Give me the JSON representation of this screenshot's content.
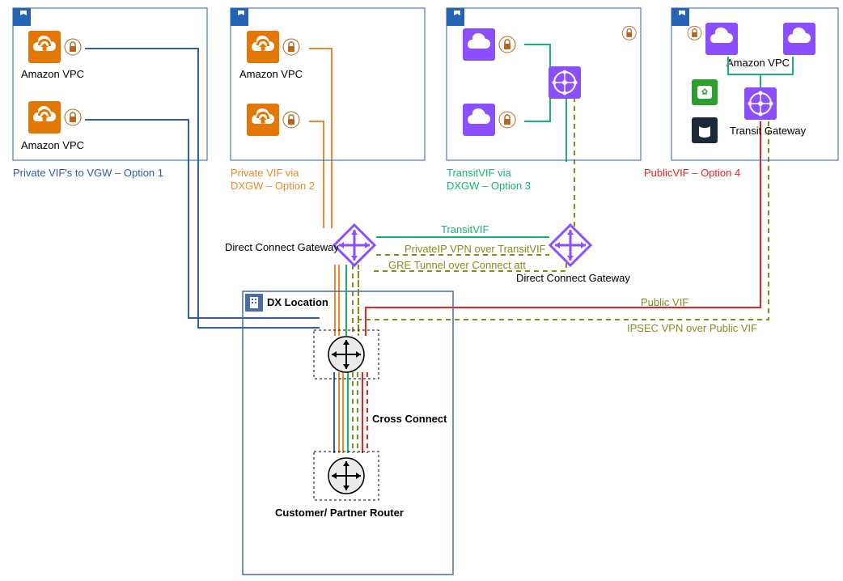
{
  "groups": {
    "g1": {
      "vpc1": "Amazon VPC",
      "vpc2": "Amazon VPC",
      "opt": "Private VIF's to VGW – Option 1"
    },
    "g2": {
      "vpc1": "Amazon VPC",
      "opt1": "Private VIF via",
      "opt2": "DXGW – Option 2"
    },
    "g3": {
      "opt1": "TransitVIF via",
      "opt2": "DXGW – Option 3"
    },
    "g4": {
      "vpc": "Amazon VPC",
      "tgw": "Transit Gateway",
      "opt": "PublicVIF – Option 4"
    }
  },
  "labels": {
    "dxgw1": "Direct Connect Gateway",
    "dxgw2": "Direct Connect Gateway",
    "transitvif": "TransitVIF",
    "privip": "PrivateIP VPN over TransitVIF",
    "gre": "GRE Tunnel over Connect att",
    "dxloc": "DX Location",
    "cross": "Cross Connect",
    "custrouter": "Customer/ Partner Router",
    "pubvif": "Public VIF",
    "ipsec": "IPSEC VPN over Public VIF"
  }
}
